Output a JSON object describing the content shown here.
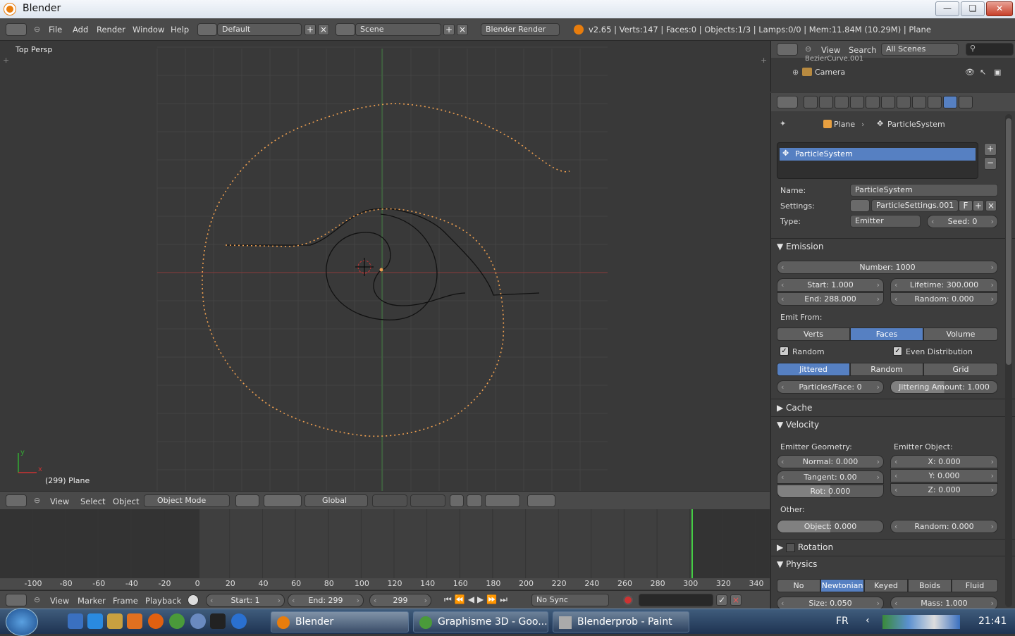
{
  "window": {
    "title": "Blender"
  },
  "topbar": {
    "menus": [
      "File",
      "Add",
      "Render",
      "Window",
      "Help"
    ],
    "layout": "Default",
    "scene": "Scene",
    "engine": "Blender Render",
    "stats": "v2.65 | Verts:147 | Faces:0 | Objects:1/3 | Lamps:0/0 | Mem:11.84M (10.29M) | Plane"
  },
  "viewport": {
    "view_label": "Top Persp",
    "object_label": "(299) Plane",
    "axis_y": "y",
    "axis_x": "x"
  },
  "view3d_header": {
    "menus": [
      "View",
      "Select",
      "Object"
    ],
    "mode": "Object Mode",
    "orientation": "Global"
  },
  "timeline": {
    "ruler": [
      "-100",
      "-80",
      "-60",
      "-40",
      "-20",
      "0",
      "20",
      "40",
      "60",
      "80",
      "100",
      "120",
      "140",
      "160",
      "180",
      "200",
      "220",
      "240",
      "260",
      "280",
      "300",
      "320",
      "340"
    ],
    "menus": [
      "View",
      "Marker",
      "Frame",
      "Playback"
    ],
    "start": "Start: 1",
    "end": "End: 299",
    "current": "299",
    "sync": "No Sync"
  },
  "outliner": {
    "menus": [
      "View",
      "Search"
    ],
    "filter": "All Scenes",
    "items": [
      "BezierCurve.001",
      "Camera"
    ]
  },
  "properties": {
    "breadcrumb": [
      "Plane",
      "ParticleSystem"
    ],
    "list_item": "ParticleSystem",
    "name_label": "Name:",
    "name_value": "ParticleSystem",
    "settings_label": "Settings:",
    "settings_value": "ParticleSettings.001",
    "settings_f": "F",
    "type_label": "Type:",
    "type_value": "Emitter",
    "seed": "Seed: 0",
    "emission": {
      "title": "Emission",
      "number": "Number: 1000",
      "start": "Start: 1.000",
      "lifetime": "Lifetime: 300.000",
      "end": "End: 288.000",
      "random": "Random: 0.000",
      "emit_from": "Emit From:",
      "emit_options": [
        "Verts",
        "Faces",
        "Volume"
      ],
      "random_check": "Random",
      "even_dist": "Even Distribution",
      "dist_options": [
        "Jittered",
        "Random",
        "Grid"
      ],
      "particles_face": "Particles/Face: 0",
      "jittering": "Jittering Amount: 1.000"
    },
    "cache": {
      "title": "Cache"
    },
    "velocity": {
      "title": "Velocity",
      "emitter_geometry": "Emitter Geometry:",
      "emitter_object": "Emitter Object:",
      "normal": "Normal: 0.000",
      "tangent": "Tangent: 0.00",
      "rot": "Rot: 0.000",
      "x": "X: 0.000",
      "y": "Y: 0.000",
      "z": "Z: 0.000",
      "other": "Other:",
      "object": "Object: 0.000",
      "random": "Random: 0.000"
    },
    "rotation": {
      "title": "Rotation"
    },
    "physics": {
      "title": "Physics",
      "options": [
        "No",
        "Newtonian",
        "Keyed",
        "Boids",
        "Fluid"
      ],
      "size": "Size: 0.050",
      "mass": "Mass: 1.000"
    }
  },
  "taskbar": {
    "tasks": [
      "Blender",
      "Graphisme 3D - Goo...",
      "Blenderprob - Paint"
    ],
    "lang": "FR",
    "clock": "21:41"
  },
  "colors": {
    "accent": "#5680c2",
    "selected_orange": "#f0a050",
    "blender_orange": "#e87d0d"
  }
}
